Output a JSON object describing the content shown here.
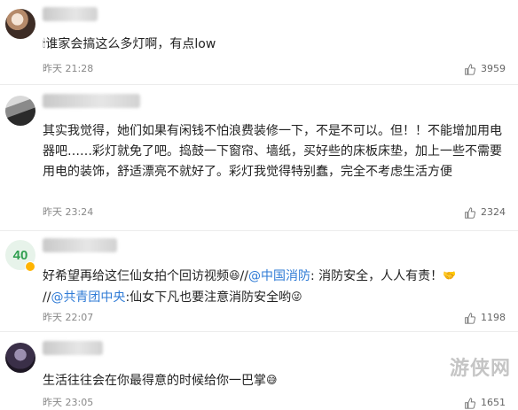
{
  "comments": [
    {
      "text": "谁家会搞这么多灯啊，有点low",
      "time": "昨天 21:28",
      "likes": "3959"
    },
    {
      "text": "其实我觉得，她们如果有闲钱不怕浪费装修一下，不是不可以。但！！不能增加用电器吧……彩灯就免了吧。捣鼓一下窗帘、墙纸，买好些的床板床垫，加上一些不需要用电的装饰，舒适漂亮不就好了。彩灯我觉得特别蠢，完全不考虑生活方便",
      "time": "昨天 23:24",
      "likes": "2324"
    },
    {
      "line1_text": "好希望再给这仨仙女拍个回访视频",
      "line1_sep": "//",
      "line1_mention": "@中国消防",
      "line1_rest": ": 消防安全，人人有责！",
      "line2_sep": "//",
      "line2_mention": "@共青团中央",
      "line2_rest": ":仙女下凡也要注意消防安全哟",
      "avatar_badge": "40",
      "time": "昨天 22:07",
      "likes": "1198"
    },
    {
      "text": "生活往往会在你最得意的时候给你一巴掌",
      "time": "昨天 23:05",
      "likes": "1651"
    }
  ],
  "watermark": "游侠网",
  "colors": {
    "mention": "#2f7bd6",
    "time": "#888888",
    "divider": "#ececec"
  },
  "icons": {
    "like": "thumbs-up-icon"
  }
}
